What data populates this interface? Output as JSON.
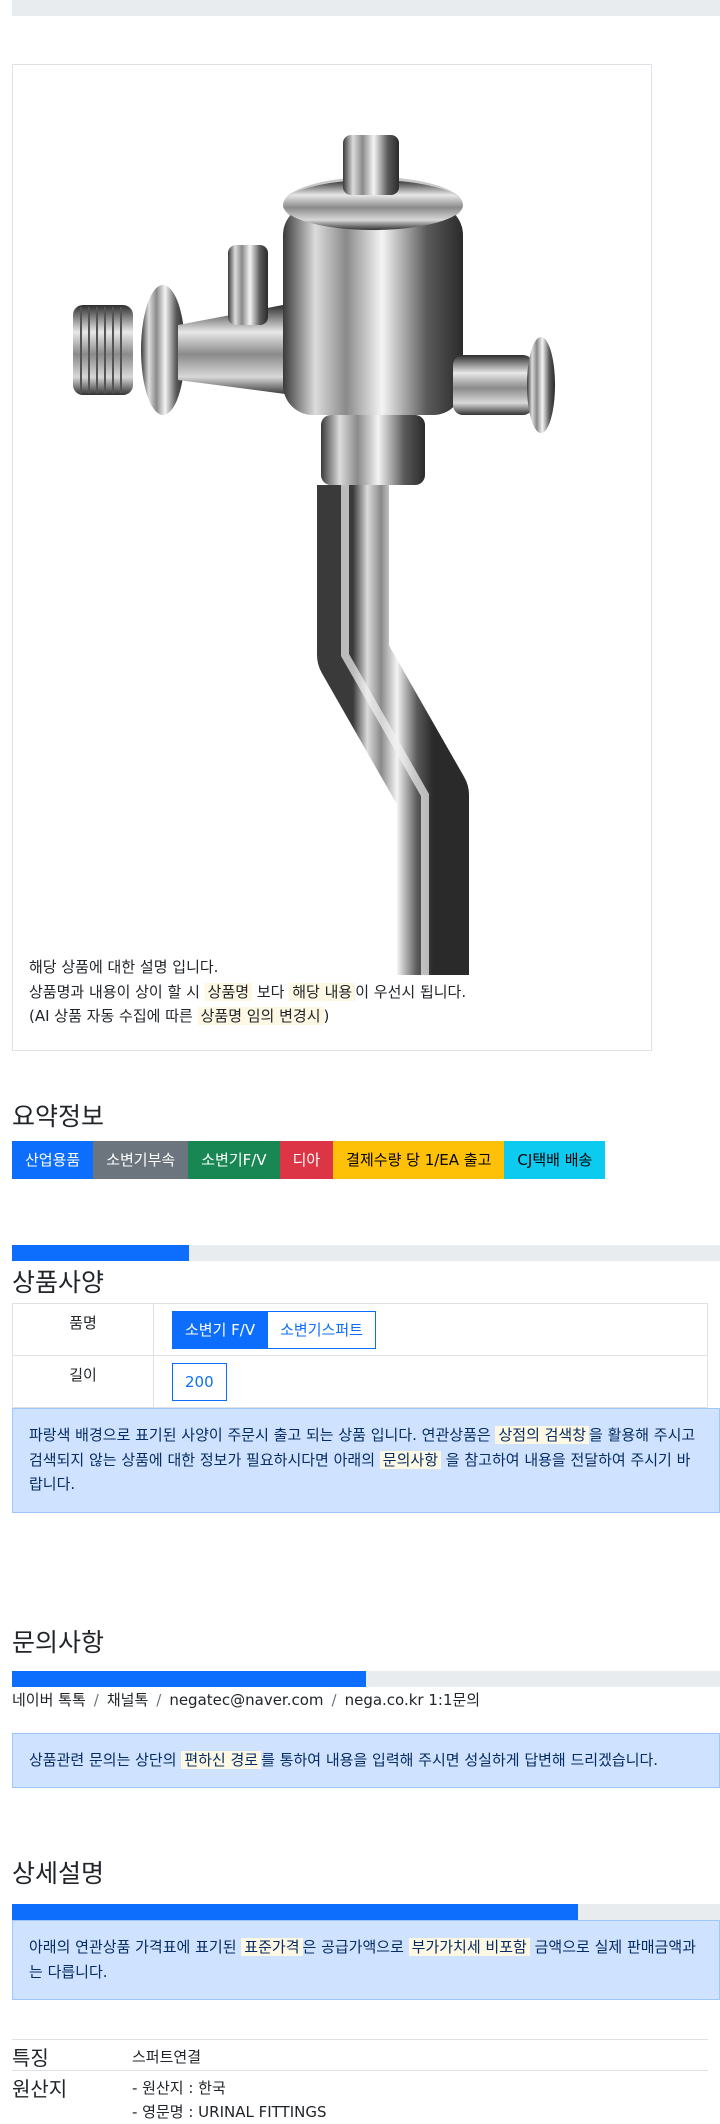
{
  "top_progress": {
    "value": 0
  },
  "product_card": {
    "image_icon": "flush-valve-image",
    "desc_line1": "해당 상품에 대한 설명 입니다.",
    "desc_line2": {
      "pre": "상품명과 내용이 상이 할 시",
      "mark1": "상품명",
      "mid": "보다",
      "mark2": "해당 내용",
      "post": "이 우선시 됩니다."
    },
    "desc_line3": {
      "pre": "(AI 상품 자동 수집에 따른",
      "mark": "상품명 임의 변경시",
      "post": ")"
    }
  },
  "summary": {
    "title": "요약정보",
    "badges": [
      {
        "label": "산업용품",
        "color": "#0d6efd",
        "text_color": "#ffffff"
      },
      {
        "label": "소변기부속",
        "color": "#6c757d",
        "text_color": "#ffffff"
      },
      {
        "label": "소변기F/V",
        "color": "#198754",
        "text_color": "#ffffff"
      },
      {
        "label": "디아",
        "color": "#dc3545",
        "text_color": "#ffffff"
      },
      {
        "label": "결제수량 당 1/EA 출고",
        "color": "#ffc107",
        "text_color": "#000000"
      },
      {
        "label": "CJ택배 배송",
        "color": "#0dcaf0",
        "text_color": "#000000"
      }
    ]
  },
  "spec": {
    "progress": 0.25,
    "title": "상품사양",
    "rows": [
      {
        "name": "품명",
        "options": [
          {
            "label": "소변기 F/V",
            "active": true
          },
          {
            "label": "소변기스퍼트",
            "active": false
          }
        ]
      },
      {
        "name": "길이",
        "options": [
          {
            "label": "200",
            "active": false
          }
        ]
      }
    ],
    "notice": {
      "pre": "파랑색 배경으로 표기된 사양이 주문시 출고 되는 상품 입니다. 연관상품은",
      "mark1": "상점의 검색창",
      "mid": "을 활용해 주시고 검색되지 않는 상품에 대한 정보가 필요하시다면 아래의",
      "mark2": "문의사항",
      "post": "을 참고하여 내용을 전달하여 주시기 바랍니다."
    }
  },
  "inquiry": {
    "title": "문의사항",
    "progress": 0.5,
    "contacts": [
      "네이버 톡톡",
      "채널톡",
      "negatec@naver.com",
      "nega.co.kr 1:1문의"
    ],
    "separator": "/",
    "notice": {
      "pre": "상품관련 문의는 상단의",
      "mark": "편하신 경로",
      "post": "를 통하여 내용을 입력해 주시면 성실하게 답변해 드리겠습니다."
    }
  },
  "detail": {
    "title": "상세설명",
    "progress": 0.8,
    "notice": {
      "pre": "아래의 연관상품 가격표에 표기된",
      "mark1": "표준가격",
      "mid": "은 공급가액으로",
      "mark2": "부가가치세 비포함",
      "post": "금액으로 실제 판매금액과는 다릅니다."
    },
    "attributes": [
      {
        "key": "특징",
        "values": [
          "스퍼트연결"
        ]
      },
      {
        "key": "원산지",
        "values": [
          "- 원산지 : 한국",
          "- 영문명 : URINAL FITTINGS"
        ]
      }
    ]
  }
}
